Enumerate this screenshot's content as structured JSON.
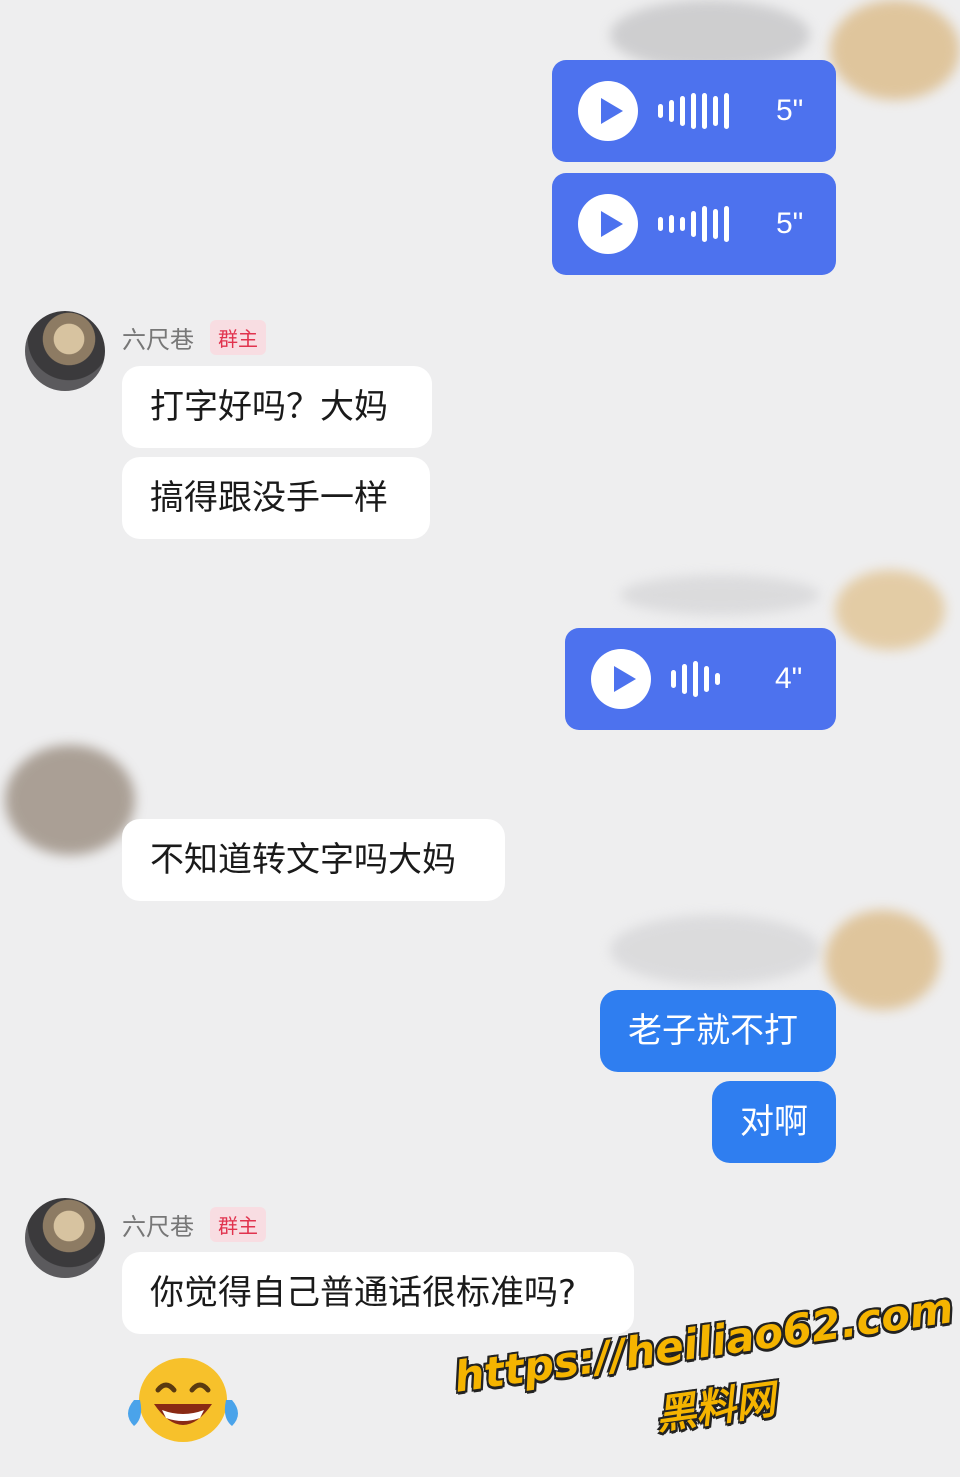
{
  "messages": {
    "voice_1": {
      "duration": "5\""
    },
    "voice_2": {
      "duration": "5\""
    },
    "sender_1": {
      "name": "六尺巷",
      "badge": "群主"
    },
    "text_1": "打字好吗？大妈",
    "text_2": "搞得跟没手一样",
    "voice_3": {
      "duration": "4\""
    },
    "text_3": "不知道转文字吗大妈",
    "out_text_1": "老子就不打",
    "out_text_2": "对啊",
    "sender_2": {
      "name": "六尺巷",
      "badge": "群主"
    },
    "text_4": "你觉得自己普通话很标准吗?",
    "emoji": "laughing-crying-emoji"
  },
  "watermark": {
    "url": "https://heiliao62.com",
    "name": "黑料网"
  },
  "colors": {
    "voice_bubble": "#4d72ee",
    "out_bubble": "#2f7ef0",
    "in_bubble": "#ffffff",
    "background": "#eeeeef",
    "badge_text": "#e1334e",
    "badge_bg": "#f8dde2"
  }
}
